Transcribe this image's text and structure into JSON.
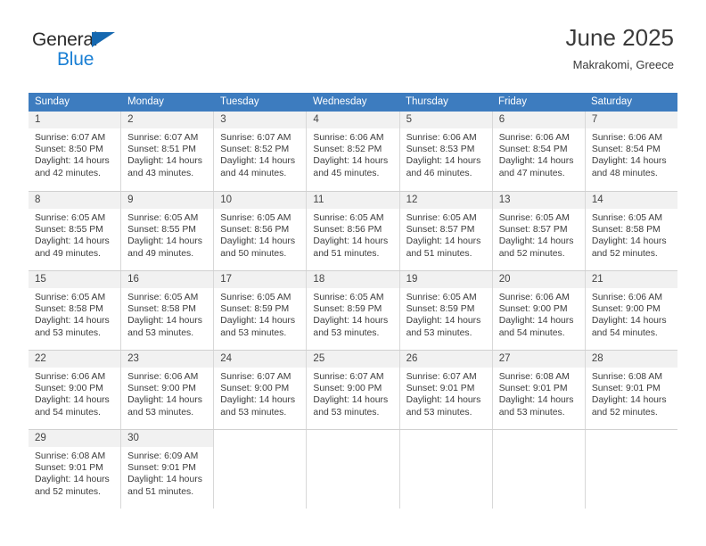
{
  "brand": {
    "name_part1": "General",
    "name_part2": "Blue",
    "triangle_icon": "triangle-icon",
    "colors": {
      "general": "#2b2b2b",
      "blue": "#1a7fd4",
      "triangle": "#1568b0"
    }
  },
  "header": {
    "month_title": "June 2025",
    "location": "Makrakomi, Greece"
  },
  "theme": {
    "header_bar": "#3d7cbf",
    "day_number_bg": "#f1f1f1",
    "cell_border": "#d8d8d8",
    "text": "#3c3c3c"
  },
  "calendar": {
    "weekday_headers": [
      "Sunday",
      "Monday",
      "Tuesday",
      "Wednesday",
      "Thursday",
      "Friday",
      "Saturday"
    ],
    "weeks": [
      [
        {
          "day": "1",
          "sunrise": "Sunrise: 6:07 AM",
          "sunset": "Sunset: 8:50 PM",
          "daylight_line1": "Daylight: 14 hours",
          "daylight_line2": "and 42 minutes."
        },
        {
          "day": "2",
          "sunrise": "Sunrise: 6:07 AM",
          "sunset": "Sunset: 8:51 PM",
          "daylight_line1": "Daylight: 14 hours",
          "daylight_line2": "and 43 minutes."
        },
        {
          "day": "3",
          "sunrise": "Sunrise: 6:07 AM",
          "sunset": "Sunset: 8:52 PM",
          "daylight_line1": "Daylight: 14 hours",
          "daylight_line2": "and 44 minutes."
        },
        {
          "day": "4",
          "sunrise": "Sunrise: 6:06 AM",
          "sunset": "Sunset: 8:52 PM",
          "daylight_line1": "Daylight: 14 hours",
          "daylight_line2": "and 45 minutes."
        },
        {
          "day": "5",
          "sunrise": "Sunrise: 6:06 AM",
          "sunset": "Sunset: 8:53 PM",
          "daylight_line1": "Daylight: 14 hours",
          "daylight_line2": "and 46 minutes."
        },
        {
          "day": "6",
          "sunrise": "Sunrise: 6:06 AM",
          "sunset": "Sunset: 8:54 PM",
          "daylight_line1": "Daylight: 14 hours",
          "daylight_line2": "and 47 minutes."
        },
        {
          "day": "7",
          "sunrise": "Sunrise: 6:06 AM",
          "sunset": "Sunset: 8:54 PM",
          "daylight_line1": "Daylight: 14 hours",
          "daylight_line2": "and 48 minutes."
        }
      ],
      [
        {
          "day": "8",
          "sunrise": "Sunrise: 6:05 AM",
          "sunset": "Sunset: 8:55 PM",
          "daylight_line1": "Daylight: 14 hours",
          "daylight_line2": "and 49 minutes."
        },
        {
          "day": "9",
          "sunrise": "Sunrise: 6:05 AM",
          "sunset": "Sunset: 8:55 PM",
          "daylight_line1": "Daylight: 14 hours",
          "daylight_line2": "and 49 minutes."
        },
        {
          "day": "10",
          "sunrise": "Sunrise: 6:05 AM",
          "sunset": "Sunset: 8:56 PM",
          "daylight_line1": "Daylight: 14 hours",
          "daylight_line2": "and 50 minutes."
        },
        {
          "day": "11",
          "sunrise": "Sunrise: 6:05 AM",
          "sunset": "Sunset: 8:56 PM",
          "daylight_line1": "Daylight: 14 hours",
          "daylight_line2": "and 51 minutes."
        },
        {
          "day": "12",
          "sunrise": "Sunrise: 6:05 AM",
          "sunset": "Sunset: 8:57 PM",
          "daylight_line1": "Daylight: 14 hours",
          "daylight_line2": "and 51 minutes."
        },
        {
          "day": "13",
          "sunrise": "Sunrise: 6:05 AM",
          "sunset": "Sunset: 8:57 PM",
          "daylight_line1": "Daylight: 14 hours",
          "daylight_line2": "and 52 minutes."
        },
        {
          "day": "14",
          "sunrise": "Sunrise: 6:05 AM",
          "sunset": "Sunset: 8:58 PM",
          "daylight_line1": "Daylight: 14 hours",
          "daylight_line2": "and 52 minutes."
        }
      ],
      [
        {
          "day": "15",
          "sunrise": "Sunrise: 6:05 AM",
          "sunset": "Sunset: 8:58 PM",
          "daylight_line1": "Daylight: 14 hours",
          "daylight_line2": "and 53 minutes."
        },
        {
          "day": "16",
          "sunrise": "Sunrise: 6:05 AM",
          "sunset": "Sunset: 8:58 PM",
          "daylight_line1": "Daylight: 14 hours",
          "daylight_line2": "and 53 minutes."
        },
        {
          "day": "17",
          "sunrise": "Sunrise: 6:05 AM",
          "sunset": "Sunset: 8:59 PM",
          "daylight_line1": "Daylight: 14 hours",
          "daylight_line2": "and 53 minutes."
        },
        {
          "day": "18",
          "sunrise": "Sunrise: 6:05 AM",
          "sunset": "Sunset: 8:59 PM",
          "daylight_line1": "Daylight: 14 hours",
          "daylight_line2": "and 53 minutes."
        },
        {
          "day": "19",
          "sunrise": "Sunrise: 6:05 AM",
          "sunset": "Sunset: 8:59 PM",
          "daylight_line1": "Daylight: 14 hours",
          "daylight_line2": "and 53 minutes."
        },
        {
          "day": "20",
          "sunrise": "Sunrise: 6:06 AM",
          "sunset": "Sunset: 9:00 PM",
          "daylight_line1": "Daylight: 14 hours",
          "daylight_line2": "and 54 minutes."
        },
        {
          "day": "21",
          "sunrise": "Sunrise: 6:06 AM",
          "sunset": "Sunset: 9:00 PM",
          "daylight_line1": "Daylight: 14 hours",
          "daylight_line2": "and 54 minutes."
        }
      ],
      [
        {
          "day": "22",
          "sunrise": "Sunrise: 6:06 AM",
          "sunset": "Sunset: 9:00 PM",
          "daylight_line1": "Daylight: 14 hours",
          "daylight_line2": "and 54 minutes."
        },
        {
          "day": "23",
          "sunrise": "Sunrise: 6:06 AM",
          "sunset": "Sunset: 9:00 PM",
          "daylight_line1": "Daylight: 14 hours",
          "daylight_line2": "and 53 minutes."
        },
        {
          "day": "24",
          "sunrise": "Sunrise: 6:07 AM",
          "sunset": "Sunset: 9:00 PM",
          "daylight_line1": "Daylight: 14 hours",
          "daylight_line2": "and 53 minutes."
        },
        {
          "day": "25",
          "sunrise": "Sunrise: 6:07 AM",
          "sunset": "Sunset: 9:00 PM",
          "daylight_line1": "Daylight: 14 hours",
          "daylight_line2": "and 53 minutes."
        },
        {
          "day": "26",
          "sunrise": "Sunrise: 6:07 AM",
          "sunset": "Sunset: 9:01 PM",
          "daylight_line1": "Daylight: 14 hours",
          "daylight_line2": "and 53 minutes."
        },
        {
          "day": "27",
          "sunrise": "Sunrise: 6:08 AM",
          "sunset": "Sunset: 9:01 PM",
          "daylight_line1": "Daylight: 14 hours",
          "daylight_line2": "and 53 minutes."
        },
        {
          "day": "28",
          "sunrise": "Sunrise: 6:08 AM",
          "sunset": "Sunset: 9:01 PM",
          "daylight_line1": "Daylight: 14 hours",
          "daylight_line2": "and 52 minutes."
        }
      ],
      [
        {
          "day": "29",
          "sunrise": "Sunrise: 6:08 AM",
          "sunset": "Sunset: 9:01 PM",
          "daylight_line1": "Daylight: 14 hours",
          "daylight_line2": "and 52 minutes."
        },
        {
          "day": "30",
          "sunrise": "Sunrise: 6:09 AM",
          "sunset": "Sunset: 9:01 PM",
          "daylight_line1": "Daylight: 14 hours",
          "daylight_line2": "and 51 minutes."
        },
        {
          "day": "",
          "sunrise": "",
          "sunset": "",
          "daylight_line1": "",
          "daylight_line2": ""
        },
        {
          "day": "",
          "sunrise": "",
          "sunset": "",
          "daylight_line1": "",
          "daylight_line2": ""
        },
        {
          "day": "",
          "sunrise": "",
          "sunset": "",
          "daylight_line1": "",
          "daylight_line2": ""
        },
        {
          "day": "",
          "sunrise": "",
          "sunset": "",
          "daylight_line1": "",
          "daylight_line2": ""
        },
        {
          "day": "",
          "sunrise": "",
          "sunset": "",
          "daylight_line1": "",
          "daylight_line2": ""
        }
      ]
    ]
  }
}
